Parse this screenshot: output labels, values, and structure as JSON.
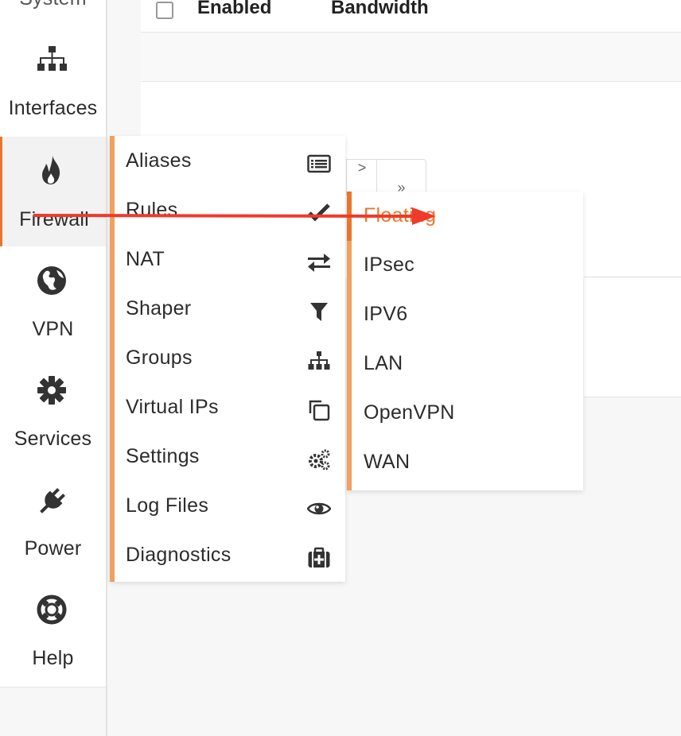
{
  "sidebar": {
    "items": [
      {
        "label": "System",
        "icon": "system-icon"
      },
      {
        "label": "Interfaces",
        "icon": "sitemap-icon"
      },
      {
        "label": "Firewall",
        "icon": "fire-icon",
        "active": true
      },
      {
        "label": "VPN",
        "icon": "globe-icon"
      },
      {
        "label": "Services",
        "icon": "gear-icon"
      },
      {
        "label": "Power",
        "icon": "plug-icon"
      },
      {
        "label": "Help",
        "icon": "lifebuoy-icon"
      }
    ]
  },
  "table": {
    "col_enabled": "Enabled",
    "col_bandwidth": "Bandwidth"
  },
  "pager": {
    "prev": ">",
    "last": "»"
  },
  "firewall_menu": {
    "items": [
      {
        "label": "Aliases",
        "icon": "list-icon"
      },
      {
        "label": "Rules",
        "icon": "check-icon"
      },
      {
        "label": "NAT",
        "icon": "exchange-icon"
      },
      {
        "label": "Shaper",
        "icon": "filter-icon"
      },
      {
        "label": "Groups",
        "icon": "sitemap-icon"
      },
      {
        "label": "Virtual IPs",
        "icon": "clone-icon"
      },
      {
        "label": "Settings",
        "icon": "gears-icon"
      },
      {
        "label": "Log Files",
        "icon": "eye-icon"
      },
      {
        "label": "Diagnostics",
        "icon": "medkit-icon"
      }
    ]
  },
  "rules_menu": {
    "items": [
      {
        "label": "Floating",
        "active": true
      },
      {
        "label": "IPsec"
      },
      {
        "label": "IPV6"
      },
      {
        "label": "LAN"
      },
      {
        "label": "OpenVPN"
      },
      {
        "label": "WAN"
      }
    ]
  },
  "colors": {
    "accent": "#e8762d",
    "accent_light": "#f0a060",
    "annotation_arrow": "#f03a2a"
  }
}
